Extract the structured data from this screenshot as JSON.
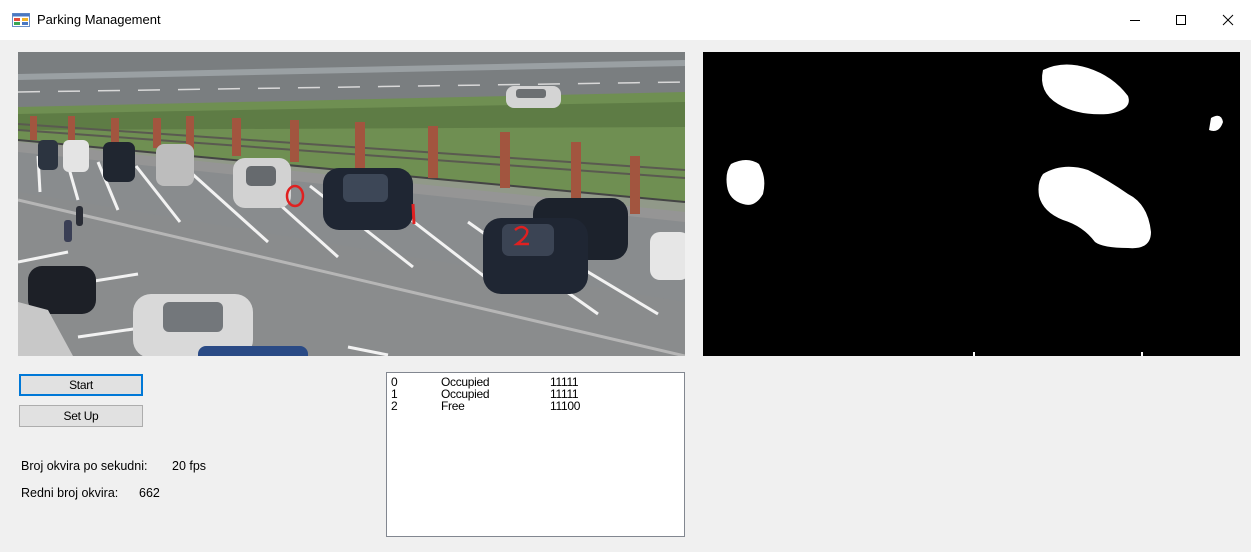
{
  "window": {
    "title": "Parking Management"
  },
  "controls": {
    "start_label": "Start",
    "setup_label": "Set Up"
  },
  "stats": {
    "fps_label": "Broj okvira po sekudni:",
    "fps_value": "20 fps",
    "frame_label": "Redni broj okvira:",
    "frame_value": "662"
  },
  "spots": [
    {
      "id": "0",
      "status": "Occupied",
      "code": "11111"
    },
    {
      "id": "1",
      "status": "Occupied",
      "code": "11111"
    },
    {
      "id": "2",
      "status": "Free",
      "code": "11100"
    }
  ],
  "overlay_labels": [
    "0",
    "1",
    "2"
  ],
  "colors": {
    "overlay_red": "#e02020",
    "focus_blue": "#0078d7"
  }
}
